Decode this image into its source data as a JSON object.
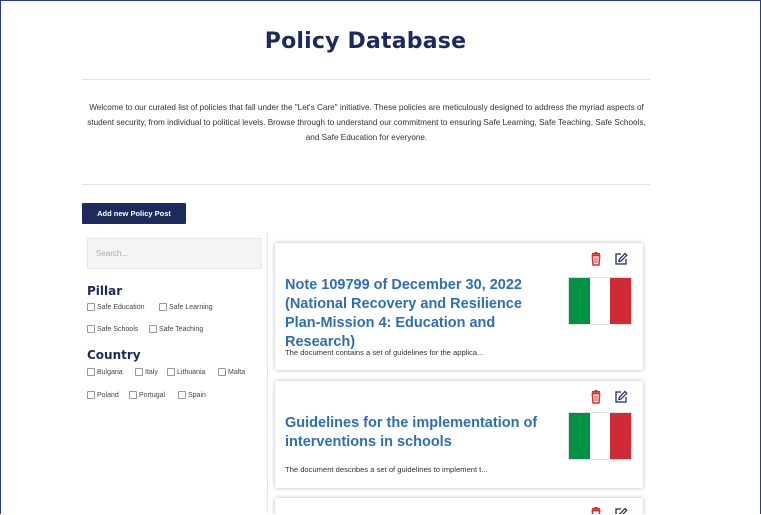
{
  "header": {
    "title": "Policy Database",
    "intro": "Welcome to our curated list of policies that fall under the \"Let's Care\" initiative. These policies are meticulously designed to address the myriad aspects of student security, from individual to political levels. Browse through to understand our commitment to ensuring Safe Learning, Safe Teaching, Safe Schools, and Safe Education for everyone."
  },
  "toolbar": {
    "add_label": "Add new Policy Post"
  },
  "search": {
    "placeholder": "Search..."
  },
  "filters": {
    "pillar": {
      "heading": "Pillar",
      "options": [
        "Safe Education",
        "Safe Learning",
        "Safe Schools",
        "Safe Teaching"
      ]
    },
    "country": {
      "heading": "Country",
      "options": [
        "Bulgaria",
        "Italy",
        "Lithuania",
        "Malta",
        "Poland",
        "Portugal",
        "Spain"
      ]
    }
  },
  "posts": [
    {
      "title": "Note 109799 of December 30, 2022 (National Recovery and Resilience Plan-Mission 4: Education and Research)",
      "description": "The document contains a set of guidelines for the applica...",
      "flag": "italy-flag"
    },
    {
      "title": "Guidelines for the implementation of interventions in schools",
      "description": "The document describes a set of guidelines to implement t...",
      "flag": "italy-flag"
    }
  ],
  "icons": {
    "delete": "trash-icon",
    "edit": "edit-icon"
  },
  "colors": {
    "brand": "#1f2a5c",
    "link": "#2d6fb5",
    "delete": "#d32f2f",
    "flag_green": "#009246",
    "flag_white": "#ffffff",
    "flag_red": "#ce2b37"
  }
}
